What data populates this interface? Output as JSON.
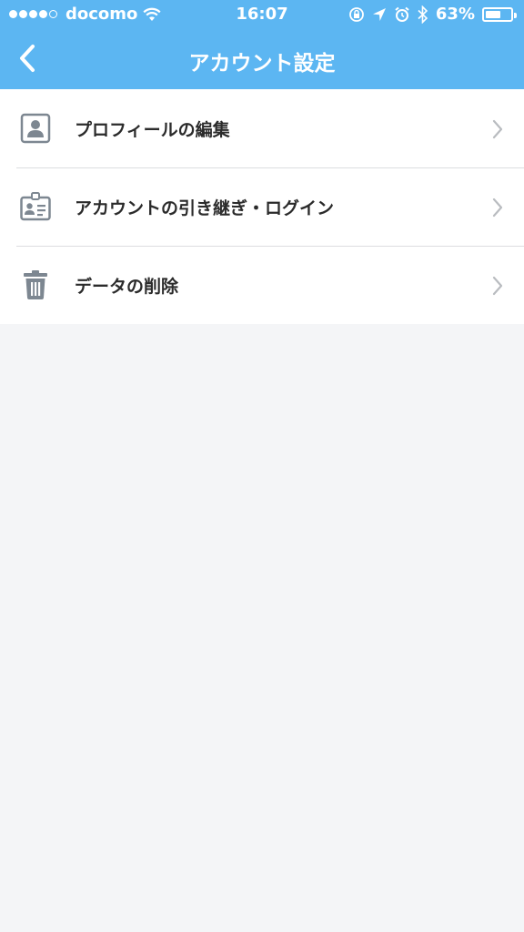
{
  "status_bar": {
    "carrier": "docomo",
    "time": "16:07",
    "battery": "63%",
    "battery_level": 0.63,
    "signal_bars": 4,
    "signal_total": 5
  },
  "nav": {
    "title": "アカウント設定",
    "back_icon": "chevron-left-icon"
  },
  "menu": {
    "items": [
      {
        "label": "プロフィールの編集",
        "icon": "profile-icon"
      },
      {
        "label": "アカウントの引き継ぎ・ログイン",
        "icon": "id-card-icon"
      },
      {
        "label": "データの削除",
        "icon": "trash-icon"
      }
    ]
  },
  "colors": {
    "header": "#5cb6f2",
    "background": "#f4f5f7",
    "icon": "#7d8791",
    "chevron": "#b9bcc0"
  }
}
